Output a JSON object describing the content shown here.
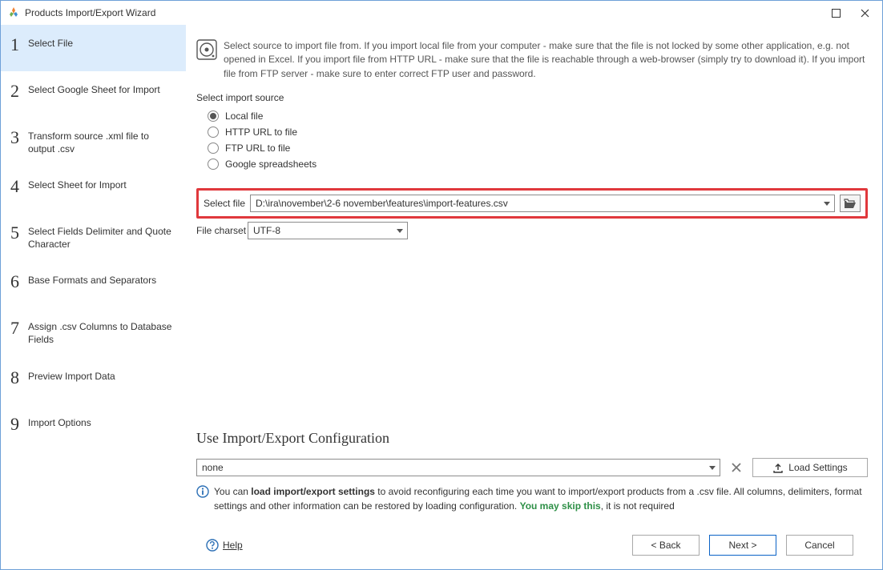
{
  "window": {
    "title": "Products Import/Export Wizard"
  },
  "sidebar": {
    "steps": [
      {
        "num": "1",
        "label": "Select File",
        "active": true
      },
      {
        "num": "2",
        "label": "Select Google Sheet for Import"
      },
      {
        "num": "3",
        "label": "Transform source .xml file to output .csv"
      },
      {
        "num": "4",
        "label": "Select Sheet for Import"
      },
      {
        "num": "5",
        "label": "Select Fields Delimiter and Quote Character"
      },
      {
        "num": "6",
        "label": "Base Formats and Separators"
      },
      {
        "num": "7",
        "label": "Assign .csv Columns to Database Fields"
      },
      {
        "num": "8",
        "label": "Preview Import Data"
      },
      {
        "num": "9",
        "label": "Import Options"
      }
    ]
  },
  "intro": "Select source to import file from. If you import local file from your computer - make sure that the file is not locked by some other application, e.g. not opened in Excel. If you import file from HTTP URL - make sure that the file is reachable through a web-browser (simply try to download it). If you import file from FTP server - make sure to enter correct FTP user and password.",
  "source": {
    "heading": "Select import source",
    "options": [
      {
        "label": "Local file",
        "selected": true
      },
      {
        "label": "HTTP URL to file",
        "selected": false
      },
      {
        "label": "FTP URL to file",
        "selected": false
      },
      {
        "label": "Google spreadsheets",
        "selected": false
      }
    ]
  },
  "file": {
    "label": "Select file",
    "value": "D:\\ira\\november\\2-6 november\\features\\import-features.csv"
  },
  "charset": {
    "label": "File charset",
    "value": "UTF-8"
  },
  "config": {
    "title": "Use Import/Export Configuration",
    "value": "none",
    "load_label": "Load Settings",
    "tip_lead": "You can ",
    "tip_bold": "load import/export settings",
    "tip_mid": " to avoid reconfiguring each time you want to import/export products from a .csv file. All columns, delimiters, format settings and other information can be restored by loading configuration. ",
    "tip_green": "You may skip this",
    "tip_tail": ", it is not required"
  },
  "footer": {
    "help": "Help",
    "back": "< Back",
    "next": "Next >",
    "cancel": "Cancel"
  }
}
